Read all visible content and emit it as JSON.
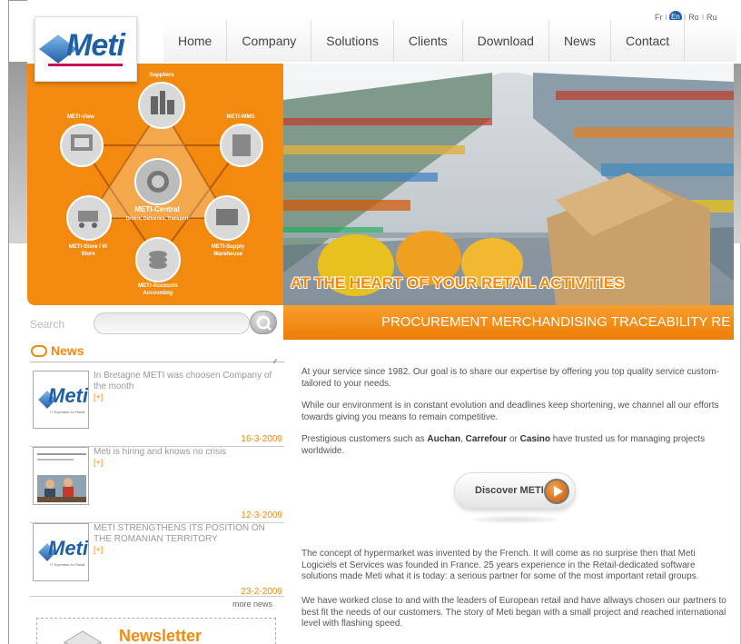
{
  "brand": {
    "logo_text": "Meti",
    "accent": "#f28a10",
    "brand_blue": "#1f5fa8"
  },
  "nav": {
    "items": [
      "Home",
      "Company",
      "Solutions",
      "Clients",
      "Download",
      "News",
      "Contact"
    ]
  },
  "languages": {
    "fr": "Fr",
    "en": "En",
    "ro": "Ro",
    "ru": "Ru",
    "active": "En"
  },
  "diagram": {
    "center": "METI-Central",
    "center_sub": "Orders, Deliveries, Transport",
    "nodes": {
      "suppliers": "Suppliers",
      "view": "METI-View",
      "wms": "METI-WMS",
      "store": "METI-Store / W",
      "store_sub": "Store",
      "supply": "METI-Supply",
      "supply_sub": "Warehouse",
      "accounts": "METI-Accounts",
      "accounts_sub": "Accounting"
    }
  },
  "banner": {
    "caption": "AT THE HEART OF YOUR RETAIL ACTIVITIES",
    "ticker": "PROCUREMENT  MERCHANDISING  TRACEABILITY  RE"
  },
  "search": {
    "label": "Search",
    "placeholder": ""
  },
  "news": {
    "title": "News",
    "items": [
      {
        "headline": "In Bretagne METI was choosen Company of the month",
        "more": "[+]",
        "date": "16-3-2009",
        "thumb": "logo"
      },
      {
        "headline": "Meti is hiring and knows no crisis",
        "more": "[+]",
        "date": "12-3-2009",
        "thumb": "photo"
      },
      {
        "headline": "METI STRENGTHENS ITS POSITION ON THE ROMANIAN TERRITORY",
        "more": "[+]",
        "date": "23-2-2009",
        "thumb": "logo"
      }
    ],
    "more_news": "more news",
    "thumb_tagline": "IT Expertise for Retail"
  },
  "newsletter": {
    "title": "Newsletter"
  },
  "content": {
    "p1": "At your service since 1982. Our goal is to share our expertise by offering you top quality service custom-tailored to your needs.",
    "p2": "While our environment is in constant evolution and deadlines keep shortening, we channel all our efforts towards giving you means to remain competitive.",
    "p3_pre": "Prestigious customers such as ",
    "p3_c1": "Auchan",
    "p3_sep1": ", ",
    "p3_c2": "Carrefour",
    "p3_sep2": " or ",
    "p3_c3": "Casino",
    "p3_post": " have trusted us for managing projects worldwide.",
    "discover_label": "Discover  METI",
    "p4": "The concept of hypermarket was invented by the French. It will come as no surprise then that Meti Logiciels et Services was founded in France. 25 years experience in the Retail-dedicated software solutions made Meti what it is today: a serious partner for some of the most important retail groups.",
    "p5": "We have worked close to and with the leaders of European retail and have allways chosen our partners to best fit the needs of our customers. The story of Meti began with a small project and reached international level with flashing speed."
  }
}
